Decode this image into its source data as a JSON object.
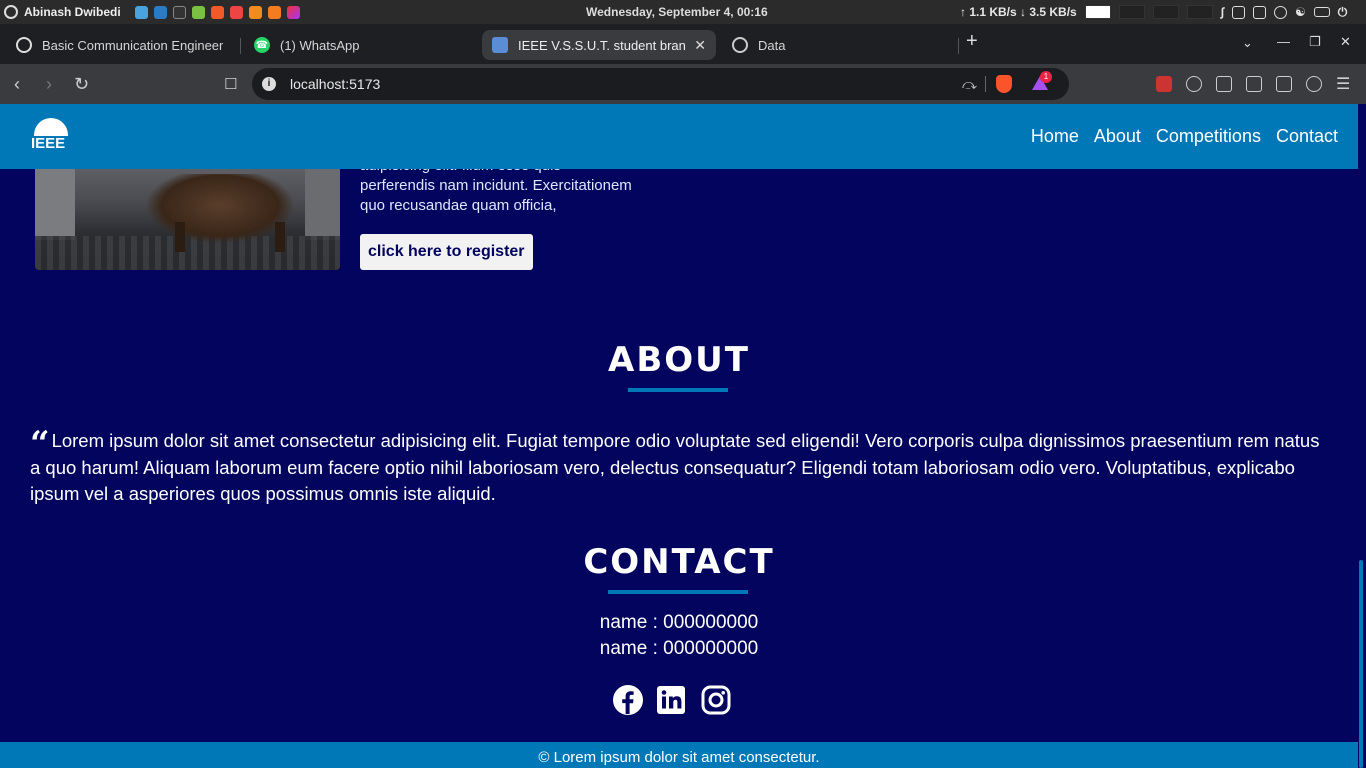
{
  "os": {
    "user": "Abinash Dwibedi",
    "clock": "Wednesday, September   4, 00:16",
    "net_speed": "↑ 1.1 KB/s ↓ 3.5 KB/s"
  },
  "browser": {
    "tabs": [
      {
        "title": "Basic Communication Engineer",
        "favicon": "chatgpt-icon",
        "active": false
      },
      {
        "title": "(1) WhatsApp",
        "favicon": "whatsapp-icon",
        "active": false
      },
      {
        "title": "IEEE V.S.S.U.T. student bran",
        "favicon": "ieee-icon",
        "active": true
      },
      {
        "title": "Data",
        "favicon": "globe-icon",
        "active": false
      }
    ],
    "url": "localhost:5173",
    "rewards_badge": "1"
  },
  "site": {
    "brand_text": "IEEE",
    "nav": [
      "Home",
      "About",
      "Competitions",
      "Contact"
    ],
    "competition": {
      "description": "adipisicing elit. Illum esse quis perferendis nam incidunt. Exercitationem quo recusandae quam officia,",
      "register_label": "click here to register"
    },
    "about": {
      "title": "ABOUT",
      "quote_mark": "“",
      "text": "Lorem ipsum dolor sit amet consectetur adipisicing elit. Fugiat tempore odio voluptate sed eligendi! Vero corporis culpa dignissimos praesentium rem natus a quo harum! Aliquam laborum eum facere optio nihil laboriosam vero, delectus consequatur? Eligendi totam laboriosam odio vero. Voluptatibus, explicabo ipsum vel a asperiores quos possimus omnis iste aliquid."
    },
    "contact": {
      "title": "CONTACT",
      "lines": [
        "name : 000000000",
        "name : 000000000"
      ],
      "socials": [
        "facebook-icon",
        "linkedin-icon",
        "instagram-icon"
      ]
    },
    "footer": "© Lorem ipsum dolor sit amet consectetur."
  },
  "colors": {
    "page_bg": "#03045e",
    "header_bg": "#0077b6",
    "accent": "#0077b6"
  }
}
